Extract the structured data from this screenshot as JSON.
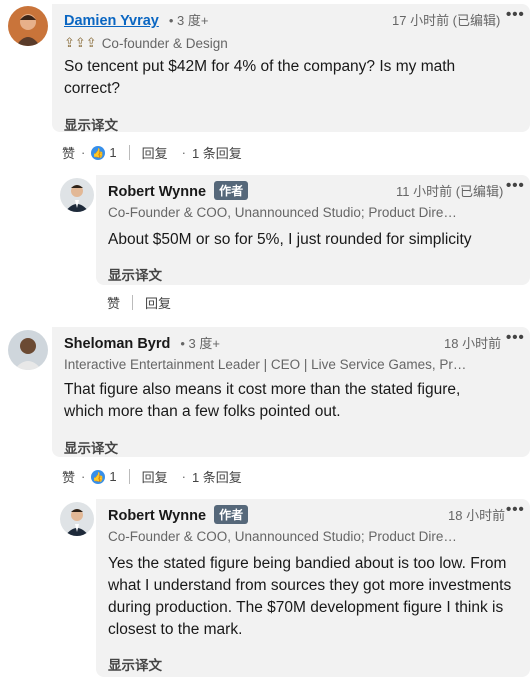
{
  "comments": [
    {
      "name": "Damien Yvray",
      "degree": "• 3 度+",
      "headline": "Co-founder & Design",
      "time": "17 小时前 (已编辑)",
      "text": "So tencent put $42M for 4% of the company? Is my math correct?",
      "translate": "显示译文",
      "actions": {
        "like": "赞",
        "like_count": "1",
        "reply": "回复",
        "reply_count": "1 条回复"
      },
      "reply": {
        "name": "Robert Wynne",
        "badge": "作者",
        "headline": "Co-Founder & COO, Unannounced Studio; Product Dire…",
        "time": "11 小时前 (已编辑)",
        "text": "About $50M or so for 5%, I just rounded for simplicity",
        "translate": "显示译文",
        "actions": {
          "like": "赞",
          "reply": "回复"
        }
      }
    },
    {
      "name": "Sheloman Byrd",
      "degree": "• 3 度+",
      "headline": "Interactive Entertainment Leader | CEO | Live Service Games, Pr…",
      "time": "18 小时前",
      "text": "That figure also means it cost more than the stated figure, which more than a few folks pointed out.",
      "translate": "显示译文",
      "actions": {
        "like": "赞",
        "like_count": "1",
        "reply": "回复",
        "reply_count": "1 条回复"
      },
      "reply": {
        "name": "Robert Wynne",
        "badge": "作者",
        "headline": "Co-Founder & COO, Unannounced Studio; Product Dire…",
        "time": "18 小时前",
        "text": "Yes the stated figure being bandied about is too low. From what I understand from sources they got more investments during production. The $70M development figure I think is closest to the mark.",
        "translate": "显示译文"
      }
    }
  ],
  "more_label": "•••",
  "colors": {
    "link": "#0a66c2",
    "bubble": "#f2f2f2",
    "like_blue": "#378fe9"
  }
}
